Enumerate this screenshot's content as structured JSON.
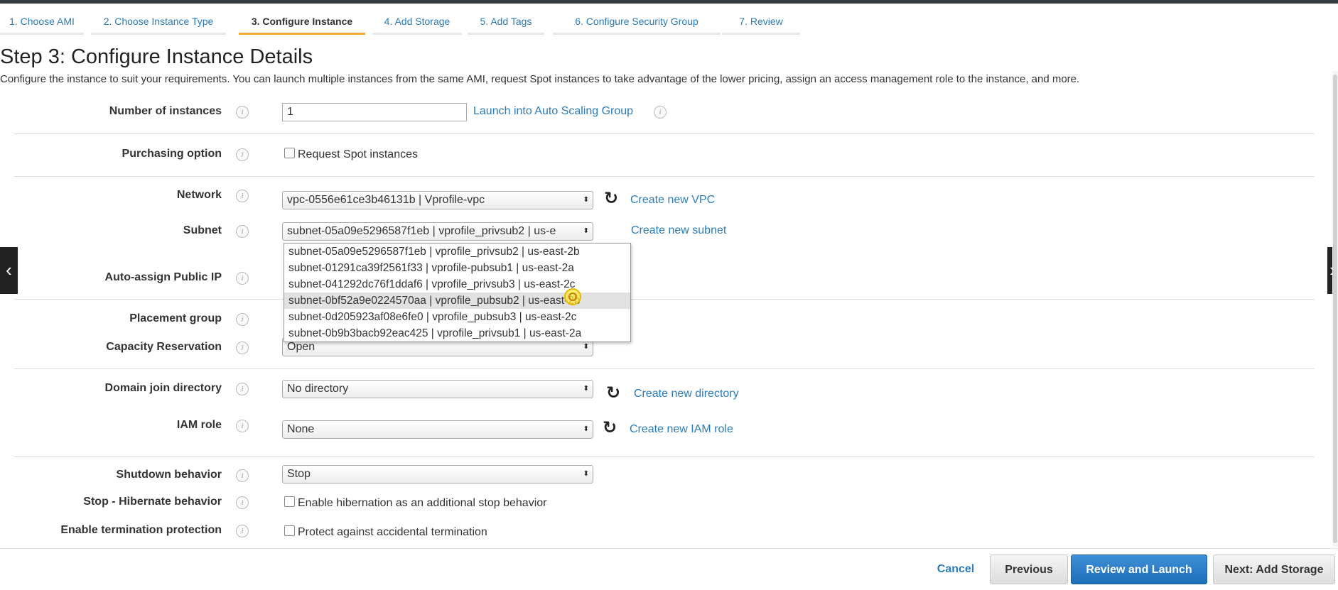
{
  "wizard": {
    "steps": [
      {
        "label": "1. Choose AMI"
      },
      {
        "label": "2. Choose Instance Type"
      },
      {
        "label": "3. Configure Instance"
      },
      {
        "label": "4. Add Storage"
      },
      {
        "label": "5. Add Tags"
      },
      {
        "label": "6. Configure Security Group"
      },
      {
        "label": "7. Review"
      }
    ],
    "active_step": 3
  },
  "page": {
    "title": "Step 3: Configure Instance Details",
    "description": "Configure the instance to suit your requirements. You can launch multiple instances from the same AMI, request Spot instances to take advantage of the lower pricing, assign an access management role to the instance, and more."
  },
  "form": {
    "number_of_instances": {
      "label": "Number of instances",
      "value": "1",
      "link": "Launch into Auto Scaling Group"
    },
    "purchasing_option": {
      "label": "Purchasing option",
      "checkbox_label": "Request Spot instances",
      "checked": false
    },
    "network": {
      "label": "Network",
      "value": "vpc-0556e61ce3b46131b | Vprofile-vpc",
      "link": "Create new VPC"
    },
    "subnet": {
      "label": "Subnet",
      "value": "subnet-05a09e5296587f1eb | vprofile_privsub2 | us-e",
      "link": "Create new subnet",
      "options": [
        "subnet-05a09e5296587f1eb | vprofile_privsub2 | us-east-2b",
        "subnet-01291ca39f2561f33 | vprofile-pubsub1 | us-east-2a",
        "subnet-041292dc76f1ddaf6 | vprofile_privsub3 | us-east-2c",
        "subnet-0bf52a9e0224570aa | vprofile_pubsub2 | us-east-2b",
        "subnet-0d205923af08e6fe0 | vprofile_pubsub3 | us-east-2c",
        "subnet-0b9b3bacb92eac425 | vprofile_privsub1 | us-east-2a"
      ],
      "highlighted_index": 3
    },
    "auto_assign_ip": {
      "label": "Auto-assign Public IP"
    },
    "placement_group": {
      "label": "Placement group"
    },
    "capacity_reservation": {
      "label": "Capacity Reservation",
      "value": "Open"
    },
    "domain_join": {
      "label": "Domain join directory",
      "value": "No directory",
      "link": "Create new directory"
    },
    "iam_role": {
      "label": "IAM role",
      "value": "None",
      "link": "Create new IAM role"
    },
    "shutdown": {
      "label": "Shutdown behavior",
      "value": "Stop"
    },
    "hibernate": {
      "label": "Stop - Hibernate behavior",
      "checkbox_label": "Enable hibernation as an additional stop behavior",
      "checked": false
    },
    "termination": {
      "label": "Enable termination protection",
      "checkbox_label": "Protect against accidental termination",
      "checked": false
    }
  },
  "footer": {
    "cancel": "Cancel",
    "previous": "Previous",
    "review_launch": "Review and Launch",
    "next": "Next: Add Storage"
  },
  "icons": {
    "info": "i",
    "refresh": "↻",
    "select_arrows": "⬍",
    "carousel_prev": "‹",
    "carousel_next": "›"
  },
  "colors": {
    "link": "#2b7bb9",
    "active_tab_underline": "#f0a830",
    "primary_button": "#1d6fb8"
  }
}
